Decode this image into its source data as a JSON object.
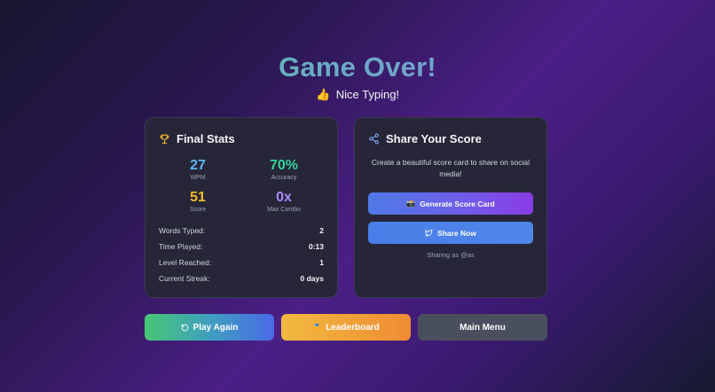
{
  "header": {
    "title": "Game Over!",
    "subtitle_emoji": "👍",
    "subtitle": "Nice Typing!"
  },
  "final_stats": {
    "title": "Final Stats",
    "icon": "trophy-icon",
    "highlights": {
      "wpm": {
        "value": "27",
        "label": "WPM"
      },
      "accuracy": {
        "value": "70%",
        "label": "Accuracy"
      },
      "score": {
        "value": "51",
        "label": "Score"
      },
      "max_combo": {
        "value": "0x",
        "label": "Max Combo"
      }
    },
    "rows": [
      {
        "label": "Words Typed:",
        "value": "2"
      },
      {
        "label": "Time Played:",
        "value": "0:13"
      },
      {
        "label": "Level Reached:",
        "value": "1"
      },
      {
        "label": "Current Streak:",
        "value": "0 days"
      }
    ]
  },
  "share": {
    "title": "Share Your Score",
    "icon": "share-icon",
    "description": "Create a beautiful score card to share on social media!",
    "generate_emoji": "📸",
    "generate_label": "Generate Score Card",
    "share_label": "Share Now",
    "share_icon": "twitter-bird-icon",
    "sharing_as": "Sharing as @as"
  },
  "actions": {
    "play_again": "Play Again",
    "play_again_icon": "refresh-icon",
    "leaderboard_emoji": "🏅",
    "leaderboard": "Leaderboard",
    "main_menu": "Main Menu"
  },
  "colors": {
    "wpm": "#5eb7f0",
    "accuracy": "#34d399",
    "score": "#fbbf24",
    "max_combo": "#a78bfa",
    "card_bg": "#262638"
  }
}
